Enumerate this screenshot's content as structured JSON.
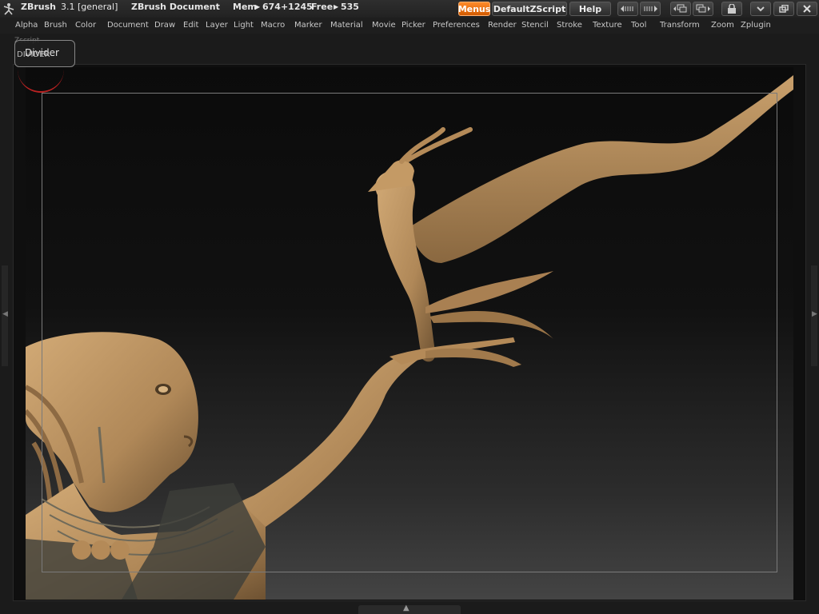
{
  "app": {
    "name": "ZBrush",
    "version": "3.1 [general]",
    "document": "ZBrush Document",
    "mem_label": "Mem",
    "mem_value": "674+1245",
    "free_label": "Free",
    "free_value": "535"
  },
  "toolbar": {
    "menus_label": "Menus",
    "script_label": "DefaultZScript",
    "help_label": "Help"
  },
  "menus": [
    "Alpha",
    "Brush",
    "Color",
    "Document",
    "Draw",
    "Edit",
    "Layer",
    "Light",
    "Macro",
    "Marker",
    "Material",
    "Movie",
    "Picker",
    "Preferences",
    "Render",
    "Stencil",
    "Stroke",
    "Texture",
    "Tool",
    "Transform",
    "Zoom",
    "Zplugin"
  ],
  "zscript_label": "Zscript",
  "tooltip": {
    "label": "Divider",
    "ghost_label": "DIVIDER"
  },
  "colors": {
    "accent": "#e87410",
    "clay": "#b8915f",
    "canvas_bg": "#111111"
  }
}
